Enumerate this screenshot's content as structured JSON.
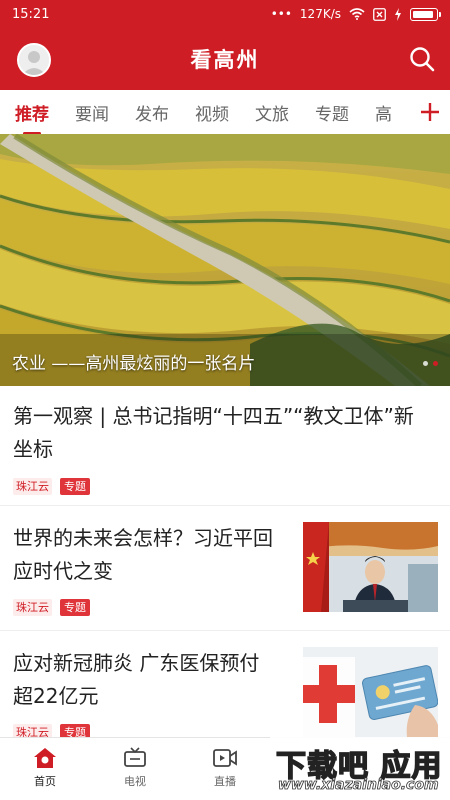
{
  "status_bar": {
    "time": "15:21",
    "network_speed": "127K/s",
    "dots": "•••",
    "battery_level": 0.9
  },
  "header": {
    "title": "看高州"
  },
  "tabs": [
    {
      "label": "推荐",
      "active": true
    },
    {
      "label": "要闻",
      "active": false
    },
    {
      "label": "发布",
      "active": false
    },
    {
      "label": "视频",
      "active": false
    },
    {
      "label": "文旅",
      "active": false
    },
    {
      "label": "专题",
      "active": false
    },
    {
      "label": "高",
      "active": false
    }
  ],
  "banner": {
    "caption": "农业 ——高州最炫丽的一张名片",
    "slides": 2,
    "active_slide": 2
  },
  "news": [
    {
      "title_line1": "第一观察 | 总书记指明“十四五”“教文卫体”新",
      "title_line2": "坐标",
      "source": "珠江云",
      "tag": "专题"
    },
    {
      "title_line1": "世界的未来会怎样？习近平回",
      "title_line2": "应时代之变",
      "source": "珠江云",
      "tag": "专题"
    },
    {
      "title_line1": "应对新冠肺炎 广东医保预付",
      "title_line2": "超22亿元",
      "source": "珠江云",
      "tag": "专题"
    }
  ],
  "bottom_nav": [
    {
      "label": "首页",
      "icon": "home-icon",
      "active": true
    },
    {
      "label": "电视",
      "icon": "tv-icon",
      "active": false
    },
    {
      "label": "直播",
      "icon": "live-icon",
      "active": false
    }
  ],
  "watermark": {
    "main": "下载吧 应用",
    "url": "www.xiazainiao.com"
  },
  "colors": {
    "brand_red": "#cf1d25",
    "tag_red": "#e0343b"
  }
}
